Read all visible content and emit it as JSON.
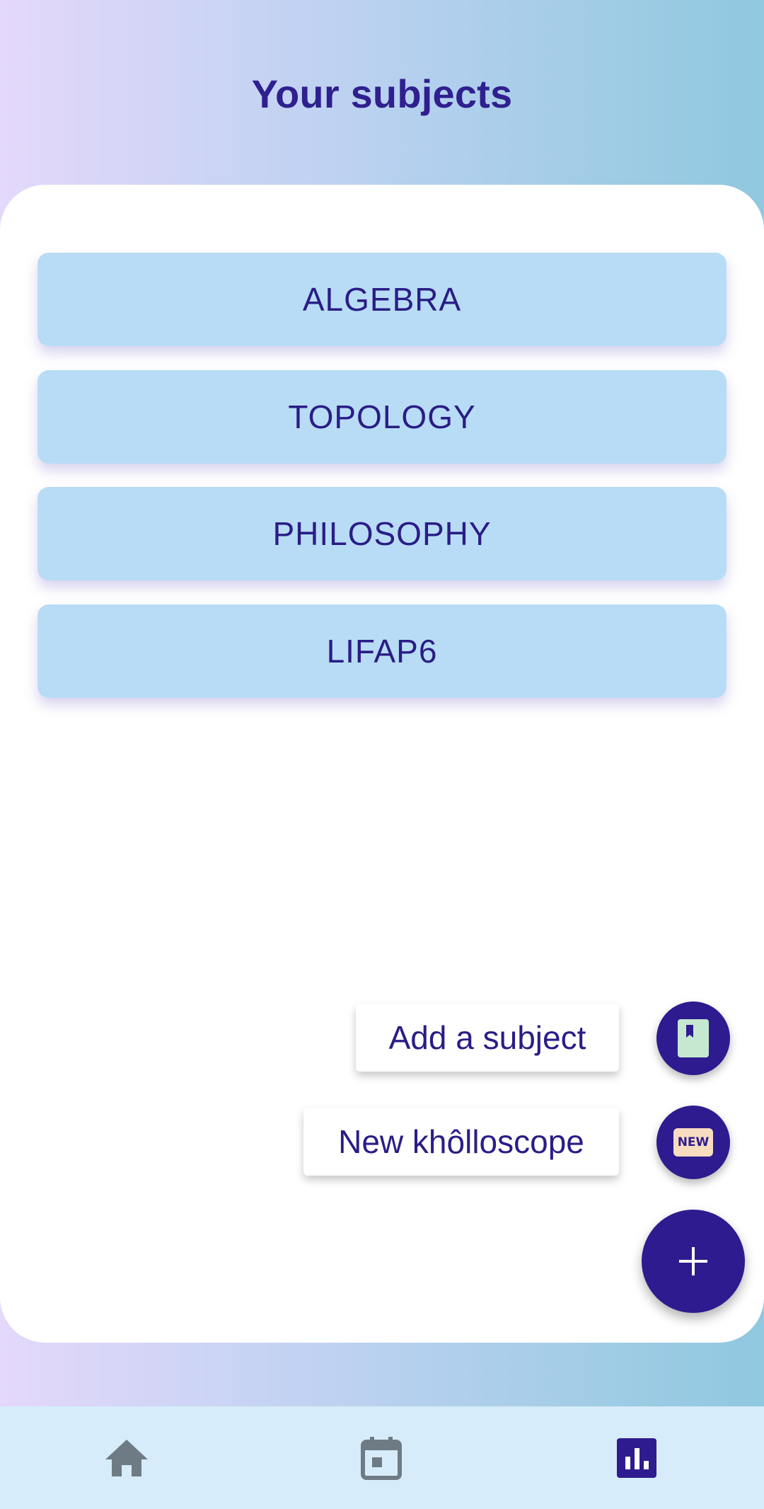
{
  "header": {
    "title": "Your subjects"
  },
  "subjects": [
    {
      "label": "ALGEBRA"
    },
    {
      "label": "TOPOLOGY"
    },
    {
      "label": "PHILOSOPHY"
    },
    {
      "label": "LIFAP6"
    }
  ],
  "fab_menu": {
    "add_subject_label": "Add a subject",
    "new_khollo_label": "New khôlloscope",
    "new_badge_text": "NEW",
    "main_icon": "plus-icon",
    "add_subject_icon": "book-icon"
  },
  "bottom_nav": {
    "items": [
      {
        "icon": "home-icon",
        "active": false
      },
      {
        "icon": "calendar-icon",
        "active": false
      },
      {
        "icon": "chart-icon",
        "active": true
      }
    ]
  },
  "colors": {
    "accent": "#2e1b8f",
    "subject_bg": "#b8dcf5",
    "nav_bg": "#d6ecfa",
    "inactive_icon": "#6f7b84"
  }
}
